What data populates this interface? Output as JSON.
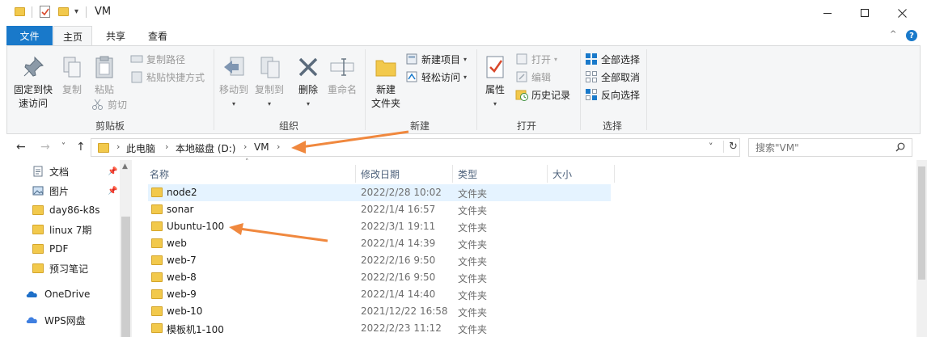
{
  "window": {
    "title": "VM"
  },
  "tabs": {
    "file": "文件",
    "home": "主页",
    "share": "共享",
    "view": "查看"
  },
  "ribbon": {
    "clipboard": {
      "label": "剪贴板",
      "pin_quick_access": "固定到快\n速访问",
      "copy": "复制",
      "paste": "粘贴",
      "copy_path": "复制路径",
      "paste_shortcut": "粘贴快捷方式",
      "cut": "剪切"
    },
    "organize": {
      "label": "组织",
      "move_to": "移动到",
      "copy_to": "复制到",
      "delete": "删除",
      "rename": "重命名"
    },
    "new": {
      "label": "新建",
      "new_folder": "新建\n文件夹",
      "new_item": "新建项目",
      "easy_access": "轻松访问"
    },
    "open": {
      "label": "打开",
      "properties": "属性",
      "open": "打开",
      "edit": "编辑",
      "history": "历史记录"
    },
    "select": {
      "label": "选择",
      "select_all": "全部选择",
      "select_none": "全部取消",
      "invert": "反向选择"
    }
  },
  "address": {
    "crumbs": [
      "此电脑",
      "本地磁盘 (D:)",
      "VM"
    ],
    "search_placeholder": "搜索\"VM\""
  },
  "nav_pane": {
    "items": [
      {
        "label": "文档",
        "icon": "document-icon",
        "pinned": true
      },
      {
        "label": "图片",
        "icon": "picture-icon",
        "pinned": true
      },
      {
        "label": "day86-k8s",
        "icon": "folder-icon"
      },
      {
        "label": "linux 7期",
        "icon": "folder-icon"
      },
      {
        "label": "PDF",
        "icon": "folder-icon"
      },
      {
        "label": "预习笔记",
        "icon": "folder-icon"
      },
      {
        "label": "OneDrive",
        "icon": "onedrive-icon"
      },
      {
        "label": "WPS网盘",
        "icon": "wps-cloud-icon"
      }
    ]
  },
  "file_list": {
    "columns": {
      "name": "名称",
      "date": "修改日期",
      "type": "类型",
      "size": "大小"
    },
    "rows": [
      {
        "name": "node2",
        "date": "2022/2/28 10:02",
        "type": "文件夹",
        "selected": true
      },
      {
        "name": "sonar",
        "date": "2022/1/4 16:57",
        "type": "文件夹"
      },
      {
        "name": "Ubuntu-100",
        "date": "2022/3/1 19:11",
        "type": "文件夹"
      },
      {
        "name": "web",
        "date": "2022/1/4 14:39",
        "type": "文件夹"
      },
      {
        "name": "web-7",
        "date": "2022/2/16 9:50",
        "type": "文件夹"
      },
      {
        "name": "web-8",
        "date": "2022/2/16 9:50",
        "type": "文件夹"
      },
      {
        "name": "web-9",
        "date": "2022/1/4 14:40",
        "type": "文件夹"
      },
      {
        "name": "web-10",
        "date": "2021/12/22 16:58",
        "type": "文件夹"
      },
      {
        "name": "模板机1-100",
        "date": "2022/2/23 11:12",
        "type": "文件夹"
      }
    ]
  },
  "colors": {
    "accent": "#1979ca",
    "folder": "#f2c94c",
    "annotation": "#f0883e",
    "selection": "#e5f3ff"
  }
}
